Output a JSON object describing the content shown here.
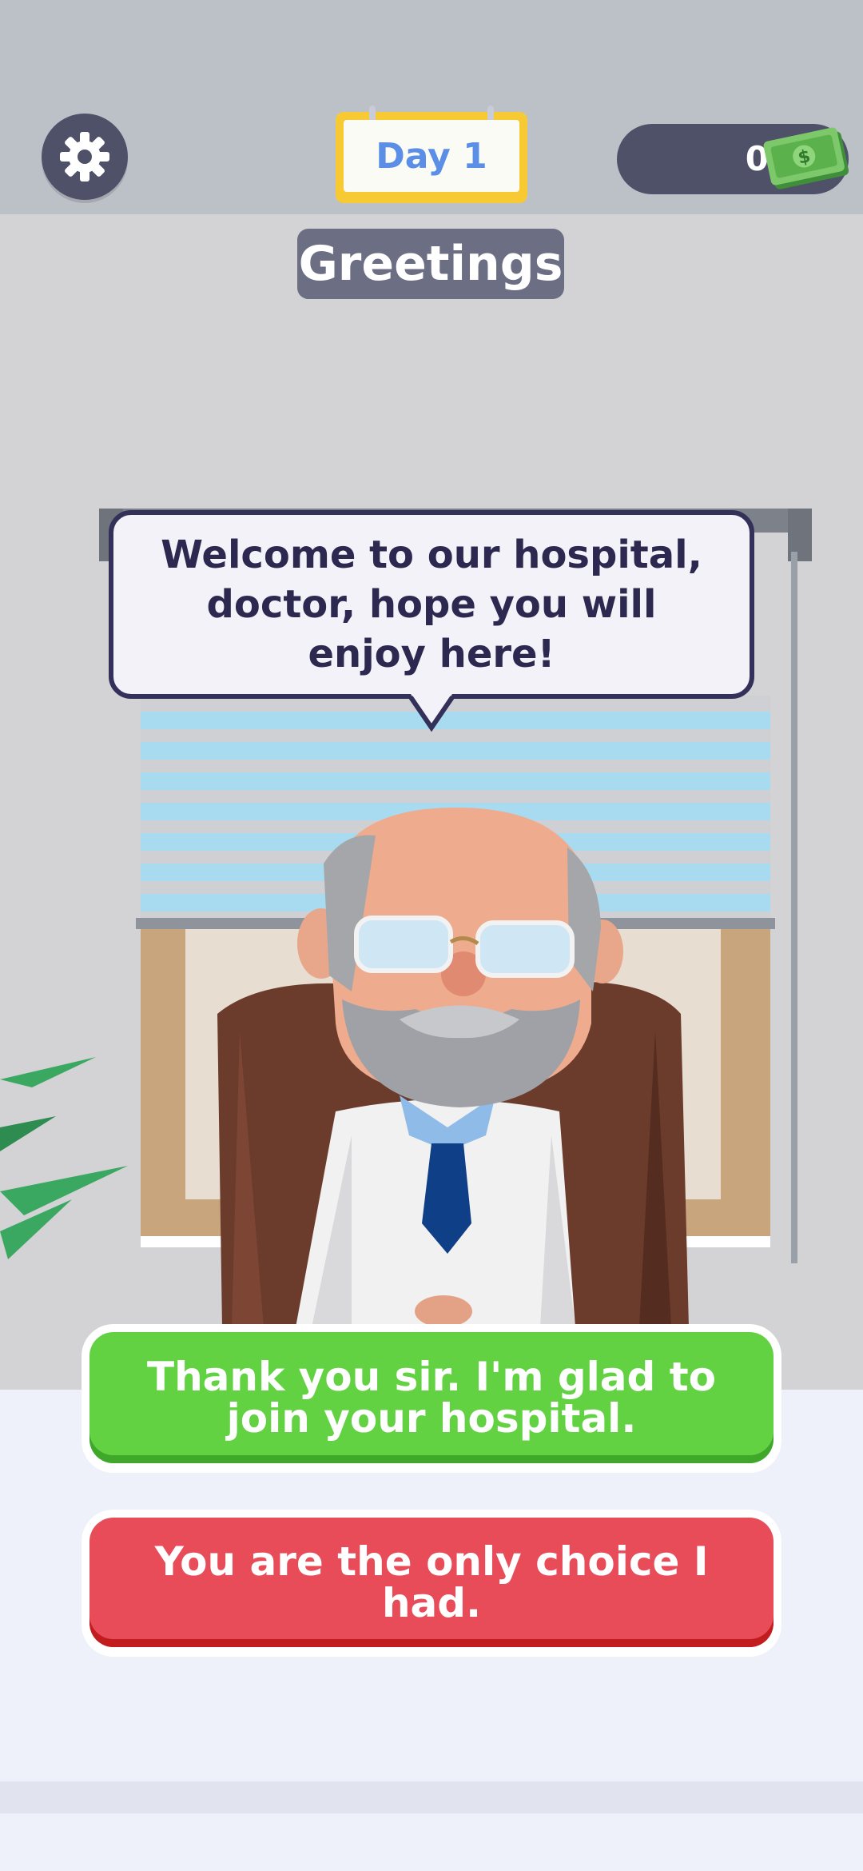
{
  "header": {
    "settings_icon": "gear-icon",
    "day_label": "Day 1",
    "money_value": "0",
    "money_icon": "cash-stack-icon"
  },
  "stage": {
    "title": "Greetings"
  },
  "dialogue": {
    "speaker_text": "Welcome to our hospital, doctor, hope you will enjoy here!"
  },
  "choices": [
    {
      "label": "Thank you sir. I'm glad to join your hospital."
    },
    {
      "label": "You are the only choice I had."
    }
  ],
  "colors": {
    "accept": "#62d243",
    "reject": "#e84c58",
    "panel": "#4f5168",
    "day_frame": "#f7c933",
    "day_text": "#5b8ee6",
    "speech_border": "#33305a"
  }
}
